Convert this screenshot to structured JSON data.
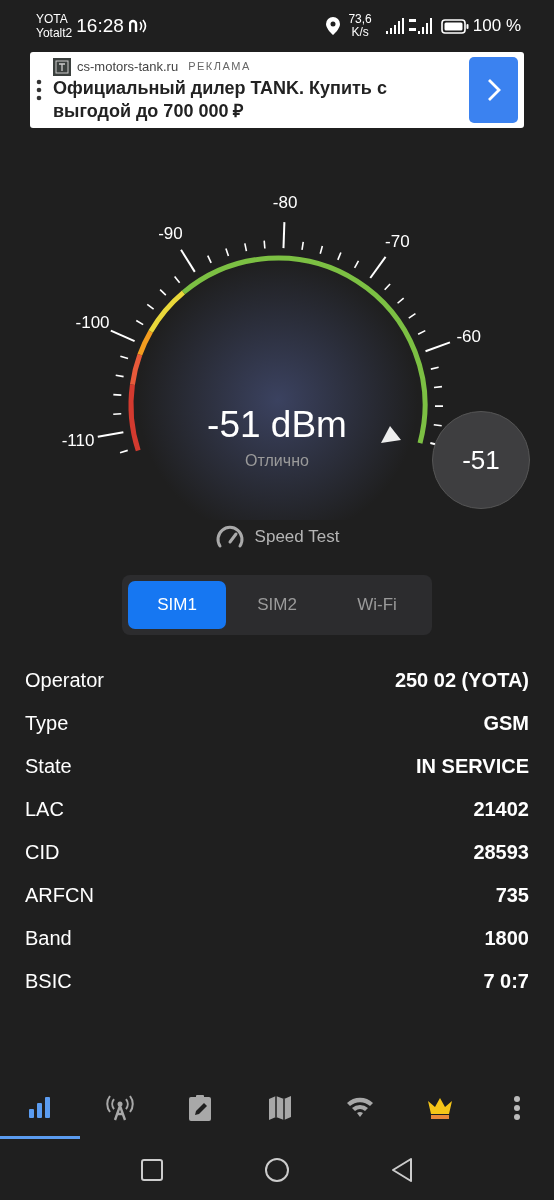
{
  "status_bar": {
    "carrier": "YOTA",
    "carrier_2": "Yotalt2",
    "time": "16:28",
    "speed_value": "73,6",
    "speed_unit": "K/s",
    "battery": "100 %"
  },
  "ad": {
    "domain": "cs-motors-tank.ru",
    "label": "РЕКЛАМА",
    "headline": "Официальный дилер TANK. Купить с выгодой до 700 000 ₽"
  },
  "gauge": {
    "scale_labels": [
      "-110",
      "-100",
      "-90",
      "-80",
      "-70",
      "-60"
    ],
    "reading": "-51 dBm",
    "quality": "Отлично",
    "badge": "-51"
  },
  "speed_test": "Speed Test",
  "tabs": [
    {
      "label": "SIM1",
      "selected": true
    },
    {
      "label": "SIM2",
      "selected": false
    },
    {
      "label": "Wi-Fi",
      "selected": false
    }
  ],
  "info": [
    {
      "label": "Operator",
      "value": "250 02 (YOTA)"
    },
    {
      "label": "Type",
      "value": "GSM"
    },
    {
      "label": "State",
      "value": "IN SERVICE"
    },
    {
      "label": "LAC",
      "value": "21402"
    },
    {
      "label": "CID",
      "value": "28593"
    },
    {
      "label": "ARFCN",
      "value": "735"
    },
    {
      "label": "Band",
      "value": "1800"
    },
    {
      "label": "BSIC",
      "value": "7 0:7"
    }
  ],
  "bottom_nav": [
    {
      "selected": true
    },
    {
      "selected": false
    },
    {
      "selected": false
    },
    {
      "selected": false
    },
    {
      "selected": false
    },
    {
      "selected": false
    }
  ]
}
